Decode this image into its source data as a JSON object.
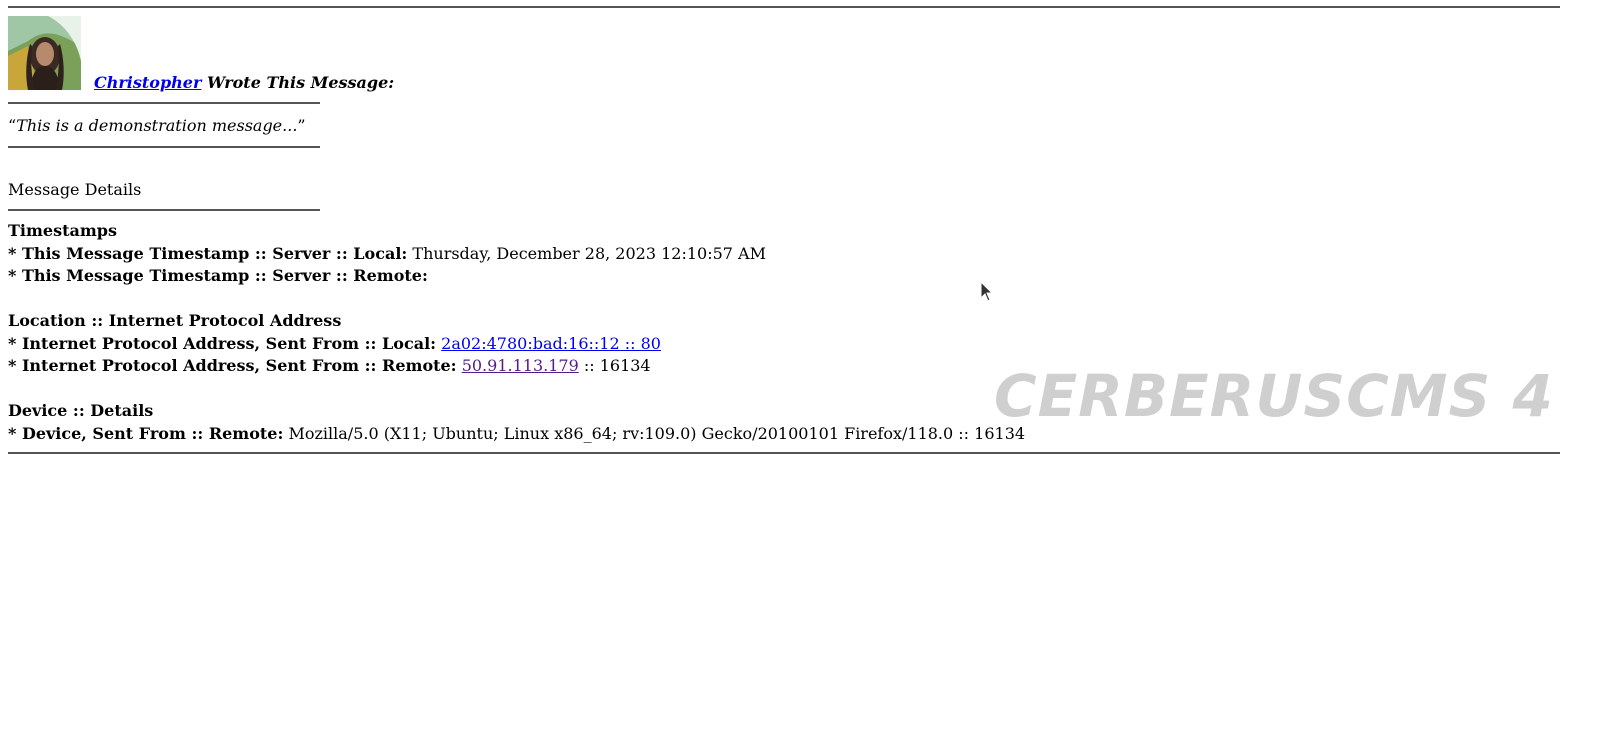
{
  "message": {
    "author_name": "Christopher",
    "author_suffix": "Wrote This Message:",
    "avatar_alt": "avatar-icon",
    "quote_open": "“",
    "quote_text": "This is a demonstration message...",
    "quote_close": "”"
  },
  "details": {
    "section_title": "Message Details",
    "timestamps": {
      "heading": "Timestamps",
      "local_label": "* This Message Timestamp :: Server :: Local:",
      "local_value": "Thursday, December 28, 2023 12:10:57 AM",
      "remote_label": "* This Message Timestamp :: Server :: Remote:",
      "remote_value": ""
    },
    "location": {
      "heading": "Location :: Internet Protocol Address",
      "local_label": "* Internet Protocol Address, Sent From :: Local:",
      "local_link": "2a02:4780:bad:16::12 :: 80",
      "remote_label": "* Internet Protocol Address, Sent From :: Remote:",
      "remote_link": "50.91.113.179",
      "remote_port": ":: 16134"
    },
    "device": {
      "heading": "Device :: Details",
      "remote_label": "* Device, Sent From :: Remote:",
      "remote_value": "Mozilla/5.0 (X11; Ubuntu; Linux x86_64; rv:109.0) Gecko/20100101 Firefox/118.0 :: 16134"
    }
  },
  "watermark": "CERBERUSCMS 4",
  "colors": {
    "link": "#0000ee",
    "visited_link": "#551a8b",
    "rule": "#555555",
    "watermark": "#cfcfcf"
  }
}
